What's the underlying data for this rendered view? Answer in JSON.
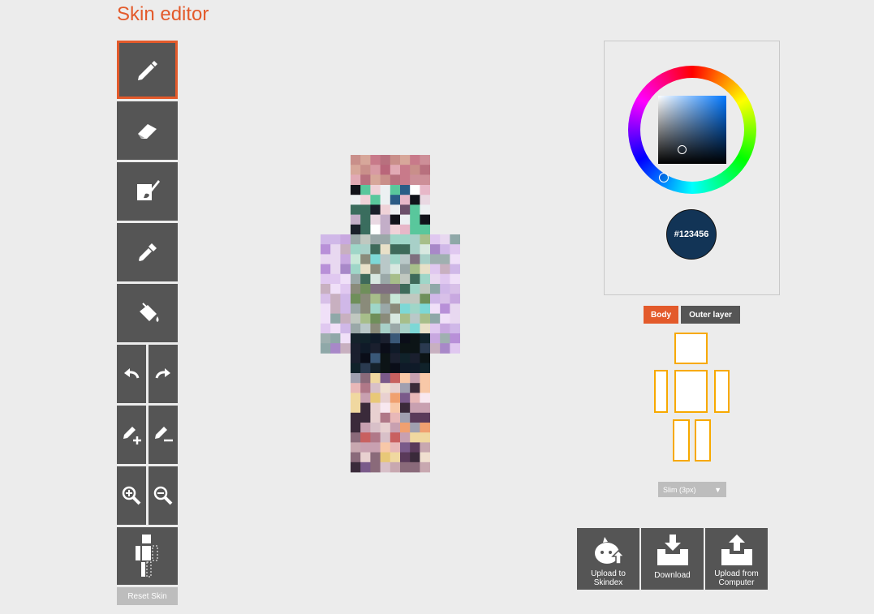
{
  "app": {
    "title": "Skin editor"
  },
  "toolbar": {
    "tools": [
      {
        "name": "pencil-tool",
        "icon": "pencil-icon",
        "active": true
      },
      {
        "name": "eraser-tool",
        "icon": "eraser-icon",
        "active": false
      },
      {
        "name": "brush-tool",
        "icon": "brush-icon",
        "active": false
      },
      {
        "name": "eyedropper-tool",
        "icon": "eyedropper-icon",
        "active": false
      },
      {
        "name": "bucket-fill-tool",
        "icon": "paint-bucket-icon",
        "active": false
      },
      {
        "name": "undo-button",
        "icon": "undo-icon"
      },
      {
        "name": "redo-button",
        "icon": "redo-icon"
      },
      {
        "name": "lighten-button",
        "icon": "lighten-icon"
      },
      {
        "name": "darken-button",
        "icon": "darken-icon"
      },
      {
        "name": "zoom-in-button",
        "icon": "zoom-in-icon"
      },
      {
        "name": "zoom-out-button",
        "icon": "zoom-out-icon"
      },
      {
        "name": "body-parts-toggle",
        "icon": "body-parts-icon"
      }
    ],
    "reset_label": "Reset Skin"
  },
  "color_picker": {
    "hex_label": "#123456",
    "current_color": "#123456"
  },
  "layers": {
    "body_label": "Body",
    "outer_label": "Outer layer",
    "active": "Body"
  },
  "model": {
    "selected": "Slim (3px)",
    "arrow": "▼"
  },
  "actions": {
    "upload_skindex": "Upload to Skindex",
    "download": "Download",
    "upload_computer": "Upload from Computer"
  },
  "colors": {
    "accent": "#e35a2b",
    "tool_bg": "#555555",
    "part_outline": "#f7a900",
    "page_bg": "#ececec"
  }
}
